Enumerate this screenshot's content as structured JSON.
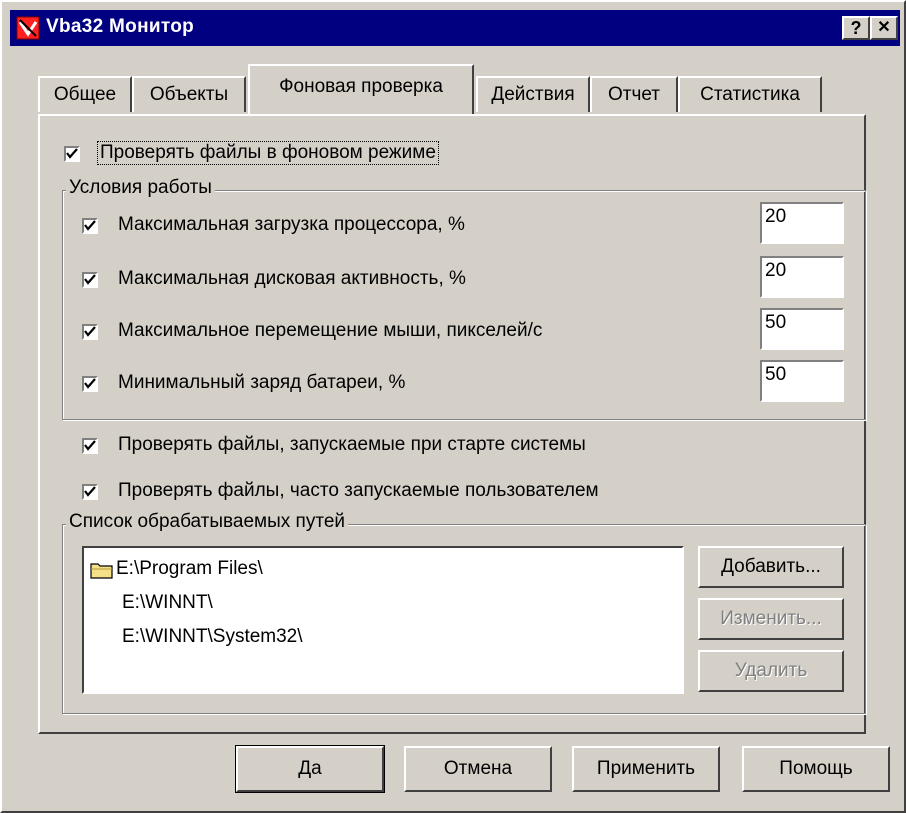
{
  "window": {
    "title": "Vba32 Монитор",
    "help_label": "?",
    "close_label": "✕"
  },
  "tabs": [
    {
      "label": "Общее"
    },
    {
      "label": "Объекты"
    },
    {
      "label": "Фоновая проверка",
      "active": true
    },
    {
      "label": "Действия"
    },
    {
      "label": "Отчет"
    },
    {
      "label": "Статистика"
    }
  ],
  "background_scan": {
    "label": "Проверять файлы в фоновом режиме",
    "checked": true
  },
  "conditions": {
    "title": "Условия работы",
    "items": [
      {
        "label": "Максимальная загрузка процессора, %",
        "value": "20",
        "checked": true
      },
      {
        "label": "Максимальная дисковая активность, %",
        "value": "20",
        "checked": true
      },
      {
        "label": "Максимальное перемещение мыши, пикселей/с",
        "value": "50",
        "checked": true
      },
      {
        "label": "Минимальный заряд батареи, %",
        "value": "50",
        "checked": true
      }
    ]
  },
  "options": [
    {
      "label": "Проверять файлы, запускаемые при старте системы",
      "checked": true
    },
    {
      "label": "Проверять файлы, часто запускаемые пользователем",
      "checked": true
    }
  ],
  "paths": {
    "title": "Список обрабатываемых путей",
    "items": [
      "E:\\Program Files\\",
      "E:\\WINNT\\",
      "E:\\WINNT\\System32\\"
    ],
    "add_label": "Добавить...",
    "edit_label": "Изменить...",
    "delete_label": "Удалить"
  },
  "buttons": {
    "ok": "Да",
    "cancel": "Отмена",
    "apply": "Применить",
    "help": "Помощь"
  },
  "colors": {
    "face": "#d4d0c8",
    "titlebar": "#000080",
    "disabled_text": "#808080"
  },
  "icons": {
    "app": "vba32-logo-icon",
    "folder": "folder-icon",
    "check": "checkmark-icon"
  }
}
